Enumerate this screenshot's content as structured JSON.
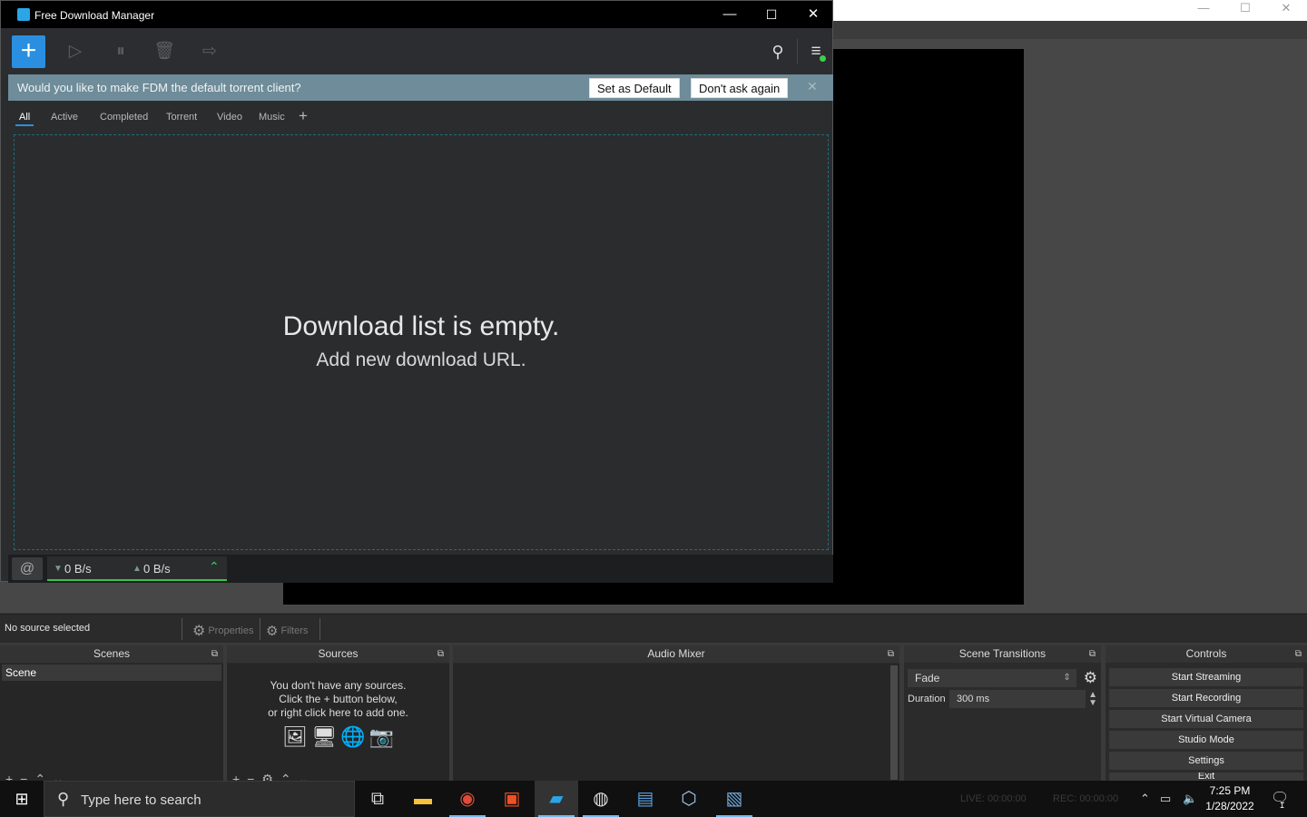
{
  "fdm": {
    "title": "Free Download Manager",
    "window_controls": {
      "minimize": "—",
      "maximize": "☐",
      "close": "✕"
    },
    "banner": {
      "question": "Would you like to make FDM the default torrent client?",
      "set_default": "Set as Default",
      "dont_ask": "Don't ask again",
      "close": "✕"
    },
    "tabs": [
      {
        "label": "All",
        "active": true
      },
      {
        "label": "Active"
      },
      {
        "label": "Completed"
      },
      {
        "label": "Torrent"
      },
      {
        "label": "Video"
      },
      {
        "label": "Music"
      }
    ],
    "add_tab": "+",
    "empty": {
      "title": "Download list is empty.",
      "subtitle": "Add new download URL."
    },
    "status": {
      "download": "0 B/s",
      "upload": "0 B/s"
    }
  },
  "obs": {
    "source_bar": {
      "no_source": "No source selected",
      "properties": "Properties",
      "filters": "Filters"
    },
    "docks": {
      "scenes": "Scenes",
      "sources": "Sources",
      "audio_mixer": "Audio Mixer",
      "scene_transitions": "Scene Transitions",
      "controls": "Controls"
    },
    "scenes": [
      "Scene"
    ],
    "sources_empty": [
      "You don't have any sources.",
      "Click the + button below,",
      "or right click here to add one."
    ],
    "transitions": {
      "type": "Fade",
      "duration_label": "Duration",
      "duration": "300 ms"
    },
    "controls": [
      "Start Streaming",
      "Start Recording",
      "Start Virtual Camera",
      "Studio Mode",
      "Settings",
      "Exit"
    ]
  },
  "taskbar": {
    "search_placeholder": "Type here to search",
    "time": "7:25 PM",
    "date": "1/28/2022",
    "live": "LIVE: 00:00:00",
    "rec": "REC: 00:00:00",
    "notification_count": "1"
  }
}
